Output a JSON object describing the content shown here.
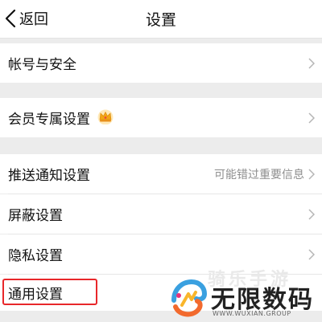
{
  "nav": {
    "back_label": "返回",
    "title": "设置"
  },
  "items": [
    {
      "label": "帐号与安全"
    },
    {
      "label": "会员专属设置",
      "badge": "crown-icon"
    },
    {
      "label": "推送通知设置",
      "hint": "可能错过重要信息"
    },
    {
      "label": "屏蔽设置"
    },
    {
      "label": "隐私设置"
    },
    {
      "label": "通用设置"
    }
  ],
  "watermark": {
    "top_text": "骑乐手游",
    "main_text": "无限数码",
    "sub_text": "WWW.WUXIAN.GROUP"
  },
  "colors": {
    "highlight_border": "#e8272a",
    "hint_text": "#8e8e8e",
    "section_gap": "#ececec"
  }
}
